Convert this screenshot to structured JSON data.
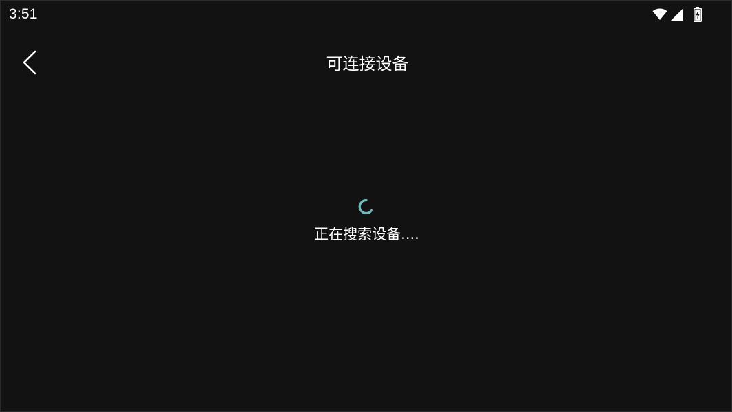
{
  "status_bar": {
    "time": "3:51",
    "icons": [
      "wifi-icon",
      "cellular-signal-icon",
      "battery-charging-icon"
    ]
  },
  "app_bar": {
    "back_icon": "chevron-left-icon",
    "title": "可连接设备"
  },
  "loading": {
    "spinner_icon": "loading-spinner-icon",
    "message": "正在搜索设备...."
  },
  "colors": {
    "background": "#121212",
    "text": "#ffffff",
    "spinner_accent": "#6fb9bf"
  }
}
